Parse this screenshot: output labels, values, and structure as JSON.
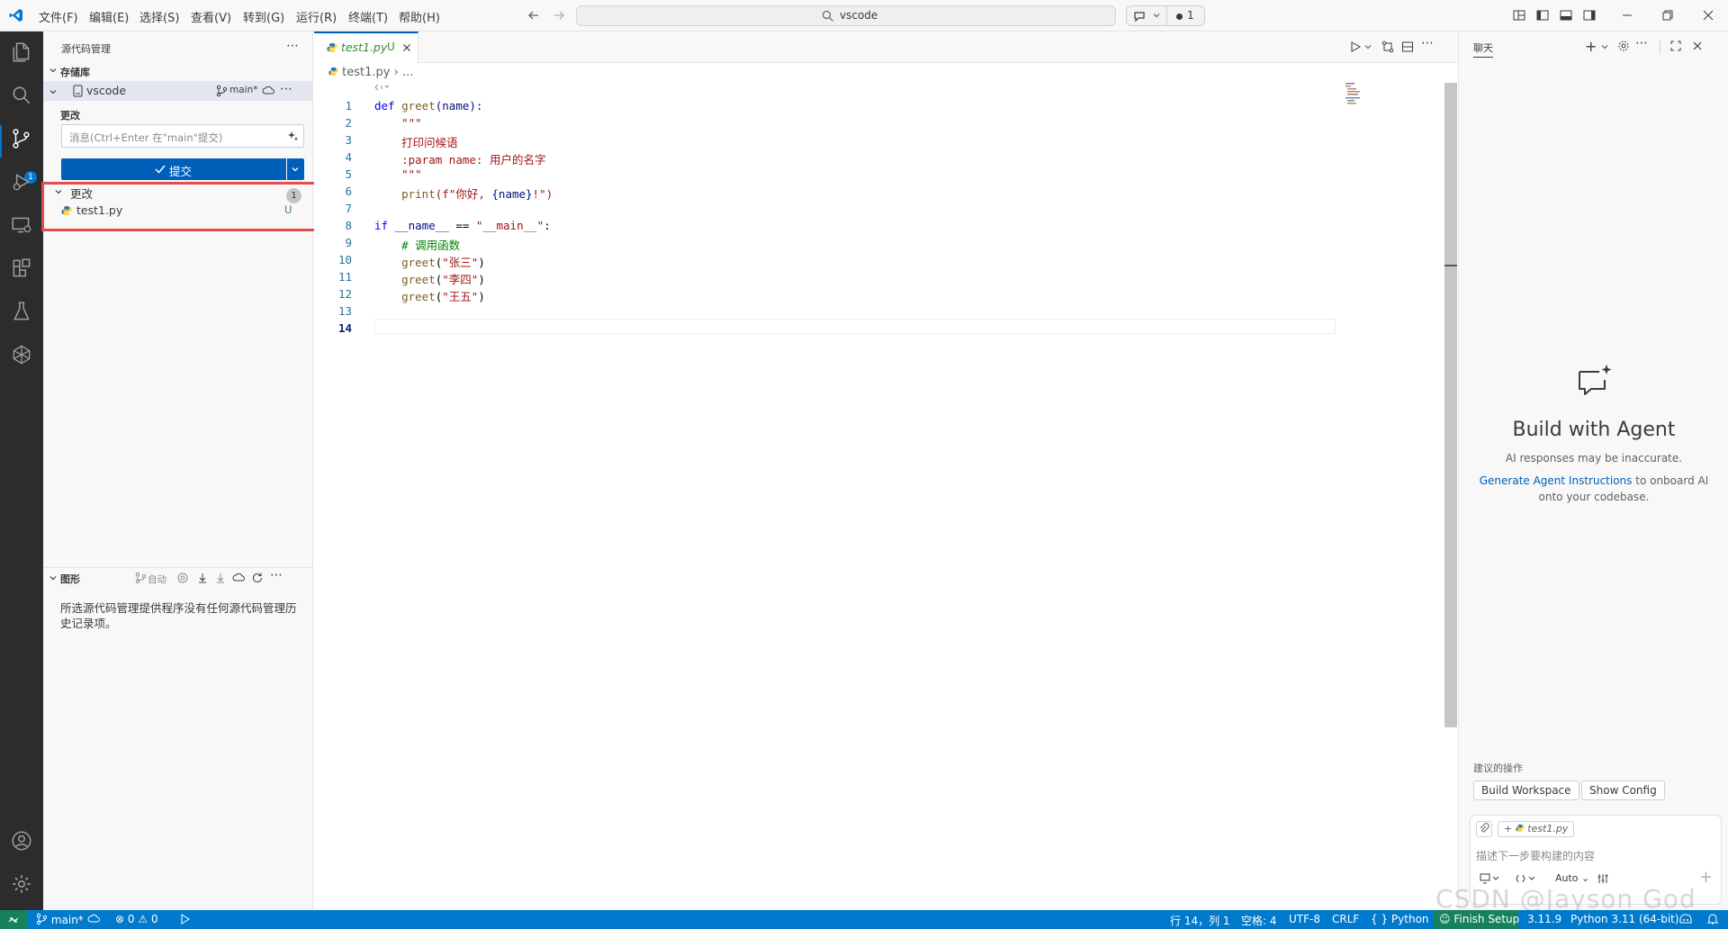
{
  "titlebar": {
    "menu": [
      "文件(F)",
      "编辑(E)",
      "选择(S)",
      "查看(V)",
      "转到(G)",
      "运行(R)",
      "终端(T)",
      "帮助(H)"
    ],
    "search": "vscode",
    "copilot_count": "1"
  },
  "activity_bar": {
    "icons": [
      "explorer-icon",
      "search-icon",
      "source-control-icon",
      "run-debug-icon",
      "remote-explorer-icon",
      "extensions-icon",
      "testing-icon",
      "copilot-agent-icon",
      "account-icon",
      "settings-icon"
    ],
    "scm_badge": "1"
  },
  "sidebar": {
    "title": "源代码管理",
    "repositories_header": "存储库",
    "repo_name": "vscode",
    "repo_branch": "main*",
    "changes_header": "更改",
    "commit_placeholder": "消息(Ctrl+Enter 在\"main\"提交)",
    "commit_button": "提交",
    "changes_group": "更改",
    "changes_count": "1",
    "file_name": "test1.py",
    "file_status": "U",
    "graph_header": "图形",
    "graph_auto": "自动",
    "graph_empty": "所选源代码管理提供程序没有任何源代码管理历史记录项。"
  },
  "editor": {
    "tab_name": "test1.py",
    "tab_status": "U",
    "breadcrumb_file": "test1.py",
    "breadcrumb_more": "...",
    "lines": [
      {
        "n": "1"
      },
      {
        "n": "2"
      },
      {
        "n": "3"
      },
      {
        "n": "4"
      },
      {
        "n": "5"
      },
      {
        "n": "6"
      },
      {
        "n": "7"
      },
      {
        "n": "8"
      },
      {
        "n": "9"
      },
      {
        "n": "10"
      },
      {
        "n": "11"
      },
      {
        "n": "12"
      },
      {
        "n": "13"
      },
      {
        "n": "14"
      }
    ],
    "code": {
      "l1_kw": "def",
      "l1_fn": "greet",
      "l1_rest": "(name):",
      "l2": "\"\"\"",
      "l3": "打印问候语",
      "l4": ":param name: 用户的名字",
      "l5": "\"\"\"",
      "l6_fn": "print",
      "l6_a": "(f\"你好, ",
      "l6_b": "{name}",
      "l6_c": "!\")",
      "l8_kw": "if",
      "l8_var": "__name__",
      "l8_op": " == ",
      "l8_str": "\"__main__\"",
      "l8_end": ":",
      "l9": "# 调用函数",
      "l10_fn": "greet",
      "l10_str": "\"张三\"",
      "l11_fn": "greet",
      "l11_str": "\"李四\"",
      "l12_fn": "greet",
      "l12_str": "\"王五\""
    }
  },
  "chat": {
    "title": "聊天",
    "heading": "Build with Agent",
    "disclaimer": "AI responses may be inaccurate.",
    "link": "Generate Agent Instructions",
    "link_rest": "to onboard AI",
    "line3": "onto your codebase.",
    "suggested_title": "建议的操作",
    "chip1": "Build Workspace",
    "chip2": "Show Config",
    "attached_file": "test1.py",
    "input_placeholder": "描述下一步要构建的内容",
    "mode": "Auto"
  },
  "statusbar": {
    "branch": "main*",
    "errors": "0",
    "warnings": "0",
    "position": "行 14，列 1",
    "spaces": "空格: 4",
    "encoding": "UTF-8",
    "eol": "CRLF",
    "language": "Python",
    "finish_setup": "Finish Setup",
    "py_version": "3.11.9",
    "interpreter": "Python 3.11 (64-bit)"
  },
  "watermark": "CSDN @Jayson God",
  "colors": {
    "accent": "#005fb8",
    "statusbar": "#007acc",
    "activitybar": "#2c2c2c",
    "highlight": "#e34d4d"
  }
}
